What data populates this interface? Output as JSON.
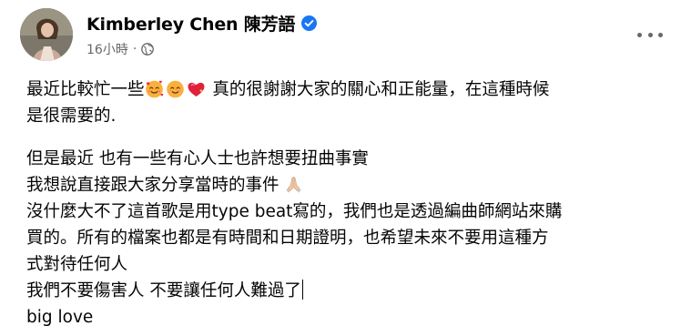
{
  "post": {
    "author_name": "Kimberley Chen 陳芳語",
    "timestamp": "16小時",
    "separator": "·",
    "audience_icon": "globe-icon",
    "verified_icon": "verified-badge-icon",
    "more_icon": "more-options-icon",
    "colors": {
      "verified": "#1877f2",
      "meta_text": "#65676b",
      "body_text": "#050505"
    },
    "text": {
      "p1_line1_a": "最近比較忙一些",
      "p1_emojis": [
        "smiling-face-with-hearts-emoji",
        "smiling-face-emoji",
        "sparkling-heart-emoji"
      ],
      "p1_line1_b": " 真的很謝謝大家的關心和正能量，在這種時候",
      "p1_line2": "是很需要的.",
      "line3": "但是最近 也有一些有心人士也許想要扭曲事實",
      "line4": "我想說直接跟大家分享當時的事件 ",
      "line4_emoji": "folded-hands-emoji",
      "line5": "沒什麼大不了這首歌是用type beat寫的，我們也是透過編曲師網站來購",
      "line6": "買的。所有的檔案也都是有時間和日期證明，也希望未來不要用這種方",
      "line7": "式對待任何人",
      "line8": "我們不要傷害人 不要讓任何人難過了",
      "line9": "big love"
    }
  }
}
